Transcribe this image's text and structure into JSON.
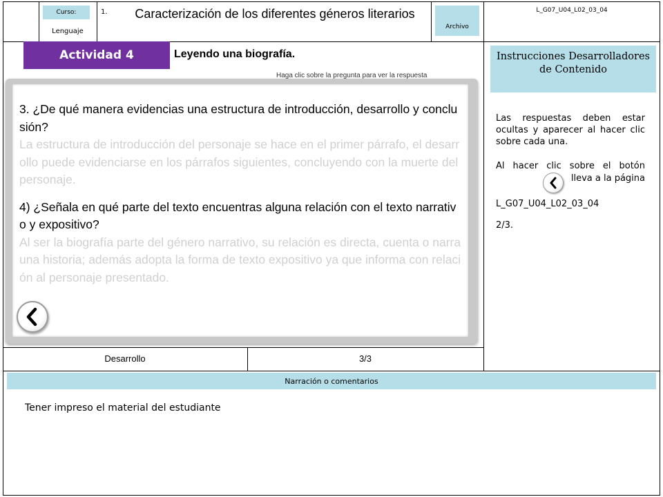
{
  "header": {
    "course_label": "Curso:",
    "course_value": "Lenguaje",
    "unit_number": "1.",
    "title": "Caracterización de los diferentes géneros literarios",
    "archive_label": "Archivo",
    "file_code": "L_G07_U04_L02_03_04"
  },
  "activity": {
    "tab_label": "Actividad 4",
    "title": "Leyendo una biografía.",
    "hint": "Haga clic sobre la pregunta para ver la respuesta"
  },
  "slide": {
    "q1": "3. ¿De qué manera evidencias una estructura de introducción, desarrollo y conclusión?",
    "a1": "La estructura de introducción del personaje se hace en el primer párrafo, el desarrollo puede evidenciarse en los párrafos siguientes, concluyendo con la muerte del personaje.",
    "q2": "4) ¿Señala en qué parte del texto encuentras alguna relación con el texto narrativo y expositivo?",
    "a2": "Al ser la biografía parte del género narrativo, su relación es directa, cuenta o narra una historia; además adopta la forma de texto expositivo ya que informa con relación al personaje presentado."
  },
  "footer": {
    "section": "Desarrollo",
    "page": "3/3"
  },
  "instructions": {
    "title": "Instrucciones Desarrolladores de Contenido",
    "p1": "Las respuestas deben estar ocultas y aparecer al hacer clic sobre cada una.",
    "p2_before": "Al hacer clic sobre el botón",
    "p2_after": "lleva a la página",
    "p2_code": "L_G07_U04_L02_03_04",
    "p2_page": "2/3."
  },
  "narration": {
    "label": "Narración o comentarios",
    "text": "Tener impreso el material del estudiante"
  },
  "colors": {
    "accent_purple": "#7030a0",
    "label_blue": "#b6dee8",
    "answer_gray": "#d0d0d0"
  },
  "icons": {
    "back_button": "chevron-left-icon"
  }
}
